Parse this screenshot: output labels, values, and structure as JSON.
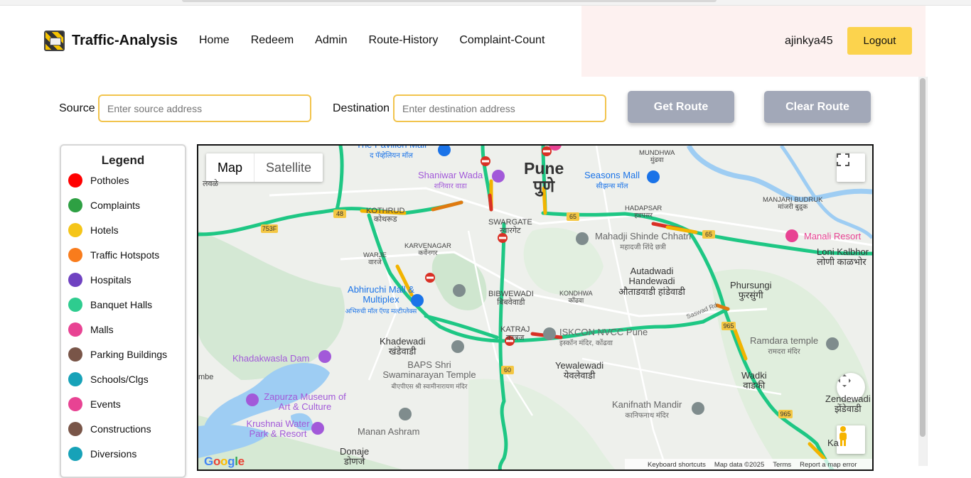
{
  "navbar": {
    "brand": "Traffic-Analysis",
    "links": [
      "Home",
      "Redeem",
      "Admin",
      "Route-History",
      "Complaint-Count"
    ],
    "username": "ajinkya45",
    "logout": "Logout"
  },
  "route": {
    "source_label": "Source",
    "source_placeholder": "Enter source address",
    "destination_label": "Destination",
    "destination_placeholder": "Enter destination address",
    "get_route": "Get Route",
    "clear_route": "Clear Route"
  },
  "legend": {
    "title": "Legend",
    "items": [
      {
        "label": "Potholes",
        "color": "#ff0000"
      },
      {
        "label": "Complaints",
        "color": "#2ea043"
      },
      {
        "label": "Hotels",
        "color": "#f5c518"
      },
      {
        "label": "Traffic Hotspots",
        "color": "#f97c1c"
      },
      {
        "label": "Hospitals",
        "color": "#6f42c1"
      },
      {
        "label": "Banquet Halls",
        "color": "#2ecc8f"
      },
      {
        "label": "Malls",
        "color": "#e84393"
      },
      {
        "label": "Parking Buildings",
        "color": "#795548"
      },
      {
        "label": "Schools/Clgs",
        "color": "#17a2b8"
      },
      {
        "label": "Events",
        "color": "#e84393"
      },
      {
        "label": "Constructions",
        "color": "#795548"
      },
      {
        "label": "Diversions",
        "color": "#17a2b8"
      }
    ]
  },
  "map": {
    "type_map": "Map",
    "type_satellite": "Satellite",
    "labels": {
      "pune_en": "Pune",
      "pune_mr": "पुणे",
      "swargate": "SWARGATE",
      "swargate_mr": "स्वारगेट",
      "kothrud": "KOTHRUD",
      "kothrud_mr": "कोथरूड",
      "karvenagar": "KARVENAGAR",
      "karvenagar_mr": "कर्वेनगर",
      "warje": "WARJE",
      "warje_mr": "वारजे",
      "bibwewadi": "BIBWEWADI",
      "bibwewadi_mr": "बिबवेवाडी",
      "kondhwa": "KONDHWA",
      "kondhwa_mr": "कोंढवा",
      "katraj": "KATRAJ",
      "katraj_mr": "कात्रज",
      "mundhwa": "MUNDHWA",
      "mundhwa_mr": "मुंढवा",
      "manjari": "MANJARI BUDRUK",
      "manjari_mr": "मांजरी बुद्रुक",
      "hadapsar": "HADAPSAR",
      "hadapsar_mr": "हडपसर",
      "autadwadi": "Autadwadi Handewadi",
      "autadwadi_mr": "औताडवाडी हांडेवाडी",
      "phursungi": "Phursungi",
      "phursungi_mr": "फुरसुंगी",
      "khadewadi": "Khadewadi",
      "khadewadi_mr": "खंडेवाडी",
      "yewalewadi": "Yewalewadi",
      "yewalewadi_mr": "येवलेवाडी",
      "wadki": "Wadki",
      "wadki_mr": "वाडकी",
      "zendewadi": "Zendewadi",
      "zendewadi_mr": "झेंडेवाडी",
      "loni": "Loni Kalbhor",
      "loni_mr": "लोणी काळभोर",
      "donaje": "Donaje",
      "donaje_mr": "डोणजे",
      "kalbhor_short": "Ka",
      "lavale": "लवळे",
      "mbe": "mbe",
      "saswad_rd": "Saswad Rd"
    },
    "pois": {
      "shaniwar_wada": "Shaniwar Wada",
      "shaniwar_wada_mr": "शनिवार वाडा",
      "seasons_mall": "Seasons Mall",
      "seasons_mall_mr": "सीझन्स मॉल",
      "mahadji": "Mahadji Shinde Chhatri",
      "mahadji_mr": "महादजी शिंदे छत्री",
      "manali": "Manali Resort",
      "abhiruchi": "Abhiruchi Mall & Multiplex",
      "abhiruchi_mr": "अभिरुची मॉल ऍण्ड मल्टीप्लेक्स",
      "iskcon": "ISKCON NVCC Pune",
      "iskcon_mr": "इस्कॉन मंदिर, कोंढवा",
      "ramdara": "Ramdara temple",
      "ramdara_mr": "रामदरा मंदिर",
      "khadakwasla": "Khadakwasla Dam",
      "baps": "BAPS Shri Swaminarayan Temple",
      "baps_mr": "बीएपीएस श्री स्वामीनारायण मंदिर",
      "zapurza": "Zapurza Museum of Art & Culture",
      "krushnai": "Krushnai Water Park & Resort",
      "manan": "Manan Ashram",
      "kanifnath": "Kanifnath Mandir",
      "kanifnath_mr": "कानिफनाथ मंदिर",
      "pavilion": "The Pavilion Mall",
      "pavilion_mr": "द पॅव्हेलियन मॉल"
    },
    "road_shields": [
      "48",
      "753F",
      "65",
      "65",
      "965",
      "965",
      "60"
    ],
    "footer": {
      "shortcuts": "Keyboard shortcuts",
      "mapdata": "Map data ©2025",
      "terms": "Terms",
      "report": "Report a map error"
    },
    "logo": "Google"
  }
}
